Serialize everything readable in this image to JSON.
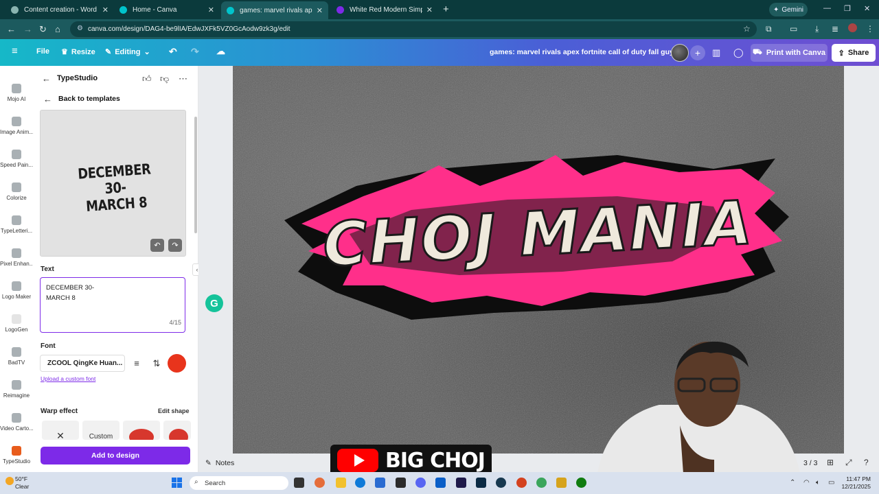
{
  "browser": {
    "tabs": [
      {
        "title": "Content creation - Word art ide",
        "favicon_color": "#8ab4b0"
      },
      {
        "title": "Home - Canva",
        "favicon_color": "#00c4cc"
      },
      {
        "title": "games: marvel rivals apex fortni",
        "favicon_color": "#00c4cc",
        "active": true
      },
      {
        "title": "White Red Modern Simple Live",
        "favicon_color": "#7d2ae8"
      }
    ],
    "new_tab": "+",
    "gemini_label": "Gemini",
    "url": "canva.com/design/DAG4-be9lIA/EdwJXFk5VZ0GcAodw9zk3g/edit"
  },
  "canva_header": {
    "menu_icon": "≡",
    "file_label": "File",
    "resize_label": "Resize",
    "editing_label": "Editing",
    "project_title": "games: marvel rivals apex fortnite call of duty fall guys",
    "print_label": "Print with Canva",
    "share_label": "Share",
    "colors": {
      "gradient_start": "#16b8c8",
      "gradient_end": "#6f4ed2"
    }
  },
  "rail": {
    "items": [
      {
        "label": "Mojo AI"
      },
      {
        "label": "Image Anim..."
      },
      {
        "label": "Speed Pain..."
      },
      {
        "label": "Colorize"
      },
      {
        "label": "TypeLetteri..."
      },
      {
        "label": "Pixel Enhan..."
      },
      {
        "label": "Logo Maker"
      },
      {
        "label": "LogoGen"
      },
      {
        "label": "BadTV"
      },
      {
        "label": "Reimagine"
      },
      {
        "label": "Video Carto..."
      },
      {
        "label": "TypeStudio"
      }
    ]
  },
  "panel": {
    "title": "TypeStudio",
    "back_to_templates": "Back to templates",
    "preview_line1": "DECEMBER 30-",
    "preview_line2": "MARCH 8",
    "text_section_label": "Text",
    "text_value_line1": "DECEMBER 30-",
    "text_value_line2": "MARCH 8",
    "char_count": "4/15",
    "font_section_label": "Font",
    "font_name": "ZCOOL QingKe Huan...",
    "font_color": "#e8341c",
    "upload_font_link": "Upload a custom font",
    "warp_label": "Warp effect",
    "edit_shape_label": "Edit shape",
    "warp_tiles": [
      "✕",
      "Custom",
      "",
      ""
    ],
    "add_button": "Add to design"
  },
  "canvas": {
    "art_title": "CHOJ MANIA",
    "art_colors": {
      "burst": "#ff2f8a",
      "letters": "#efe9dc",
      "background": "#5d5d5d"
    },
    "notes_label": "Notes",
    "page_indicator": "3 / 3"
  },
  "overlay": {
    "channel_name": "BIG CHOJ"
  },
  "taskbar": {
    "temperature": "50°F",
    "condition": "Clear",
    "search_placeholder": "Search",
    "time": "11:47 PM",
    "date": "12/21/2025"
  }
}
